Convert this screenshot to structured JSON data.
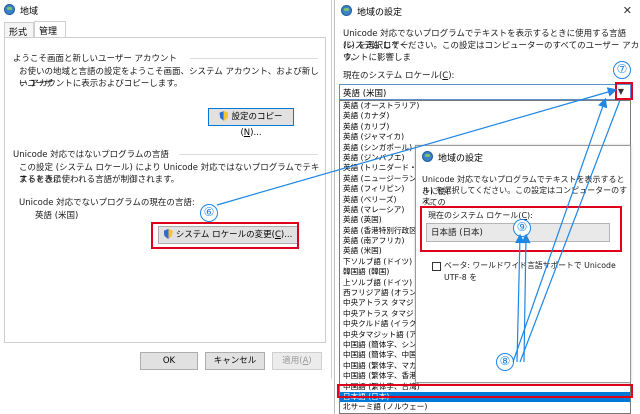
{
  "region_window": {
    "title": "地域",
    "tabs": [
      "形式",
      "管理"
    ],
    "welcome_group": {
      "title": "ようこそ画面と新しいユーザー アカウント",
      "desc_line1": "お使いの地域と言語の設定をようこそ画面、システム アカウント、および新しいユーザ",
      "desc_line2": "ー アカウントに表示およびコピーします。",
      "copy_button": "設定のコピー(",
      "copy_button_key": "N",
      "copy_button_tail": ")..."
    },
    "unicode_group": {
      "title": "Unicode 対応ではないプログラムの言語",
      "desc_line1": "この設定 (システム ロケール) により Unicode 対応ではないプログラムでテキストを表示",
      "desc_line2": "するときに使われる言語が制御されます。",
      "current_label": "Unicode 対応でないプログラムの現在の言語:",
      "current_value": "英語 (米国)",
      "change_button": "システム ロケールの変更(",
      "change_button_key": "C",
      "change_button_tail": ")..."
    },
    "ok_button": "OK",
    "cancel_button": "キャンセル",
    "apply_button": "適用(",
    "apply_button_key": "A",
    "apply_button_tail": ")"
  },
  "locale_window": {
    "title": "地域の設定",
    "desc_line1": "Unicode 対応でないプログラムでテキストを表示するときに使用する言語 (システム ロケー",
    "desc_line2": "ル) を選択してください。この設定はコンピューターのすべてのユーザー アカウントに影響しま",
    "desc_line3": "す。",
    "current_label": "現在のシステム ロケール(",
    "current_label_key": "C",
    "current_label_tail": "):",
    "current_value": "英語 (米国)",
    "dropdown_items": [
      "英語 (オーストラリア)",
      "英語 (カナダ)",
      "英語 (カリブ)",
      "英語 (ジャマイカ)",
      "英語 (シンガポール)",
      "英語 (ジンバブエ)",
      "英語 (トリニダード・トバゴ)",
      "英語 (ニュージーランド)",
      "英語 (フィリピン)",
      "英語 (ベリーズ)",
      "英語 (マレーシア)",
      "英語 (英国)",
      "英語 (香港特別行政区)",
      "英語 (南アフリカ)",
      "英語 (米国)",
      "下ソルブ語 (ドイツ)",
      "韓国語 (韓国)",
      "上ソルブ語 (ドイツ)",
      "西フリジア語 (オランダ)",
      "中央アトラス タマジット語 (ティフィナグ、モロッコ)",
      "中央アトラス タマジット語 (ラテン、アルジェリア)",
      "中央クルド語 (イラク)",
      "中央タマジット語 (アラビア、モロッコ)",
      "中国語 (簡体字、シンガポール)",
      "中国語 (簡体字、中国)",
      "中国語 (繁体字、マカオ)",
      "中国語 (繁体字、香港特別行政区)",
      "中国語 (繁体字、台湾)",
      "日本語 (日本)",
      "北サーミ語 (ノルウェー)"
    ],
    "selected_index": 28
  },
  "overlay_dialog": {
    "title": "地域の設定",
    "desc_line1": "Unicode 対応でないプログラムでテキストを表示するときに使(",
    "desc_line2": "ル) を選択してください。この設定はコンピューターのすべての",
    "desc_line3": "す。",
    "current_label": "現在のシステム ロケール(",
    "current_label_key": "C",
    "current_label_tail": "):",
    "current_value": "日本語 (日本)",
    "beta_checkbox_label": "ベータ: ワールドワイド言語サポートで Unicode UTF-8 を"
  },
  "annotations": {
    "six": "⑥",
    "seven": "⑦",
    "eight": "⑧",
    "nine": "⑨"
  },
  "colors": {
    "annotation_red": "#e0001b",
    "annotation_blue": "#1e86e5",
    "selection_blue": "#0078d7"
  }
}
